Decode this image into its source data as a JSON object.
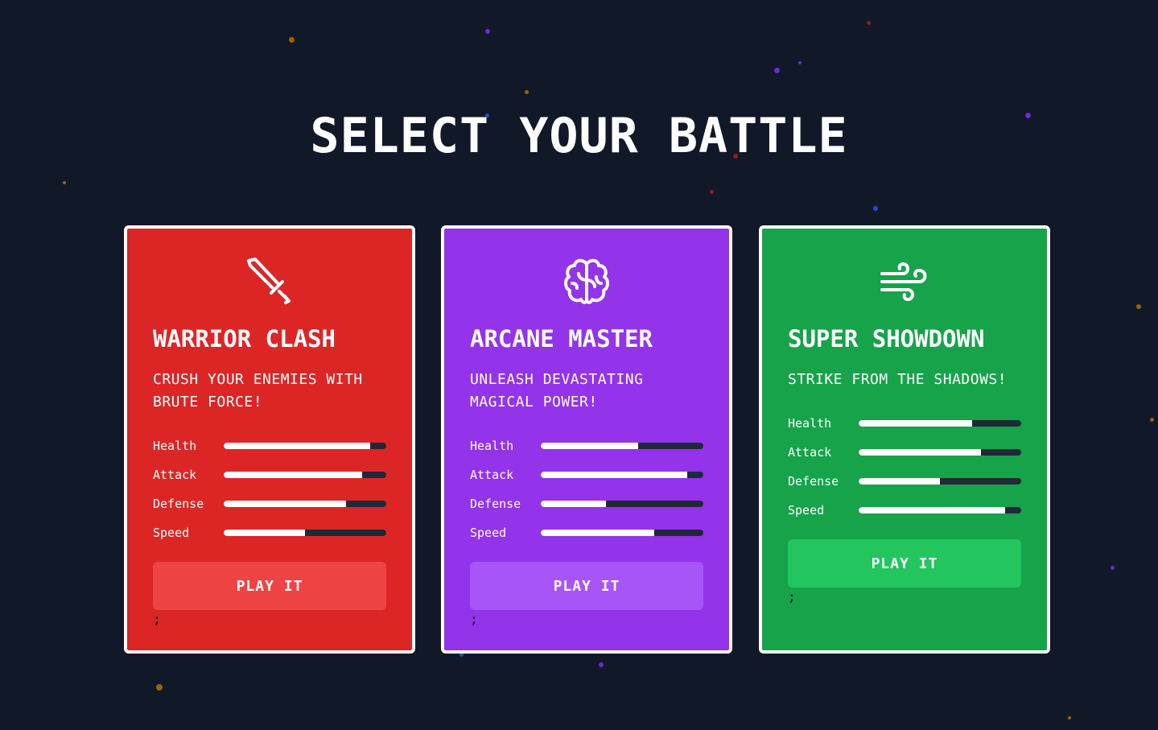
{
  "page_title": "SELECT YOUR BATTLE",
  "cards": [
    {
      "name": "WARRIOR CLASH",
      "description": "CRUSH YOUR ENEMIES WITH BRUTE FORCE!",
      "icon": "sword-icon",
      "color": "#dc2626",
      "button_color": "#ef4444",
      "stats": [
        {
          "label": "Health",
          "value": 0.9
        },
        {
          "label": "Attack",
          "value": 0.85
        },
        {
          "label": "Defense",
          "value": 0.75
        },
        {
          "label": "Speed",
          "value": 0.5
        }
      ],
      "button_label": "PLAY IT",
      "stray_text": ";"
    },
    {
      "name": "ARCANE MASTER",
      "description": "UNLEASH DEVASTATING MAGICAL POWER!",
      "icon": "brain-icon",
      "color": "#9333ea",
      "button_color": "#a855f7",
      "stats": [
        {
          "label": "Health",
          "value": 0.6
        },
        {
          "label": "Attack",
          "value": 0.9
        },
        {
          "label": "Defense",
          "value": 0.4
        },
        {
          "label": "Speed",
          "value": 0.7
        }
      ],
      "button_label": "PLAY IT",
      "stray_text": ";"
    },
    {
      "name": "SUPER SHOWDOWN",
      "description": "STRIKE FROM THE SHADOWS!",
      "icon": "wind-icon",
      "color": "#16a34a",
      "button_color": "#22c55e",
      "stats": [
        {
          "label": "Health",
          "value": 0.7
        },
        {
          "label": "Attack",
          "value": 0.75
        },
        {
          "label": "Defense",
          "value": 0.5
        },
        {
          "label": "Speed",
          "value": 0.9
        }
      ],
      "button_label": "PLAY IT",
      "stray_text": ";"
    }
  ]
}
